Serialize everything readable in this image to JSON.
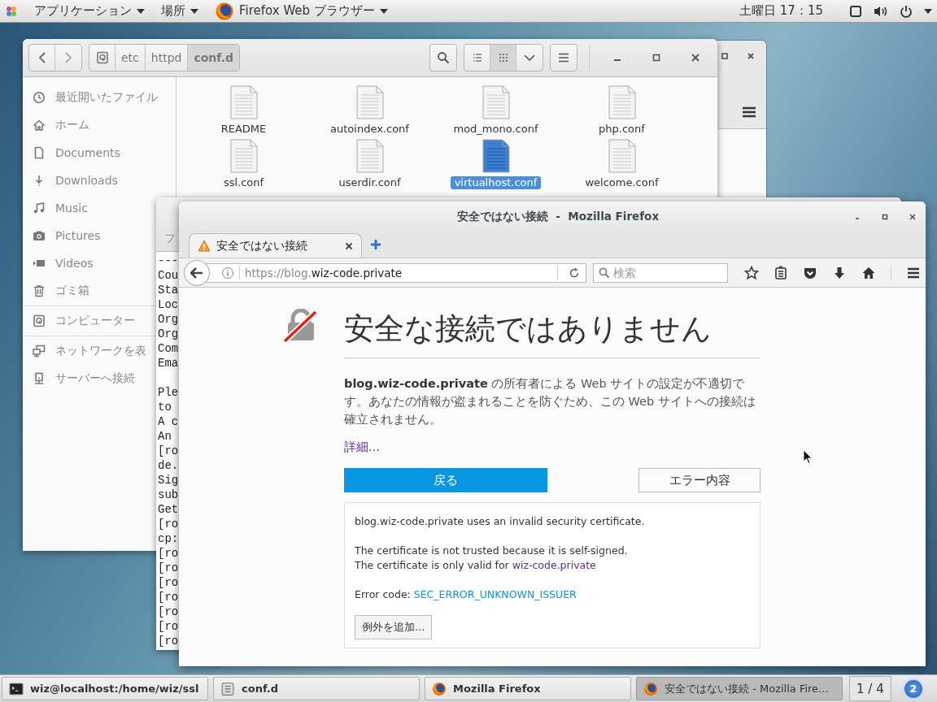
{
  "top_bar": {
    "applications_menu": "アプリケーション",
    "places_menu": "場所",
    "app_menu": "Firefox Web ブラウザー",
    "clock": "土曜日 17：15"
  },
  "file_manager": {
    "path": [
      {
        "label": "etc",
        "selected": false
      },
      {
        "label": "httpd",
        "selected": false
      },
      {
        "label": "conf.d",
        "selected": true
      }
    ],
    "view_buttons": [
      {
        "kind": "list",
        "selected": false
      },
      {
        "kind": "grid",
        "selected": true
      }
    ],
    "sidebar": {
      "sections": [
        {
          "items": [
            {
              "kind": "recent",
              "label": "最近開いたファイル"
            },
            {
              "kind": "home",
              "label": "ホーム"
            },
            {
              "kind": "document",
              "label": "Documents"
            },
            {
              "kind": "download",
              "label": "Downloads"
            },
            {
              "kind": "music",
              "label": "Music"
            },
            {
              "kind": "pictures",
              "label": "Pictures"
            },
            {
              "kind": "videos",
              "label": "Videos"
            },
            {
              "kind": "trash",
              "label": "ゴミ箱"
            }
          ]
        },
        {
          "items": [
            {
              "kind": "computer",
              "label": "コンピューター"
            }
          ]
        },
        {
          "items": [
            {
              "kind": "network",
              "label": "ネットワークを表"
            },
            {
              "kind": "server",
              "label": "サーバーへ接続"
            }
          ]
        }
      ]
    },
    "files": [
      {
        "name": "README",
        "selected": false
      },
      {
        "name": "autoindex.conf",
        "selected": false
      },
      {
        "name": "mod_mono.conf",
        "selected": false
      },
      {
        "name": "php.conf",
        "selected": false
      },
      {
        "name": "ssl.conf",
        "selected": false
      },
      {
        "name": "userdir.conf",
        "selected": false
      },
      {
        "name": "virtualhost.conf",
        "selected": true
      },
      {
        "name": "welcome.conf",
        "selected": false
      }
    ]
  },
  "terminal": {
    "menu": "フ",
    "blocks": [
      [
        "---",
        "Cou",
        "Sta",
        "Loc",
        "Org",
        "Org",
        "Com",
        "Ema"
      ],
      [
        "Ple",
        "to",
        "A c",
        "An",
        "[ro",
        "de.",
        "Sig",
        "sub",
        "Get",
        "[ro",
        "cp:",
        "[ro",
        "[ro",
        "[ro",
        "[ro",
        "[ro",
        "[ro",
        "[ro"
      ]
    ]
  },
  "browser": {
    "title": "安全ではない接続  -  Mozilla Firefox",
    "tab": {
      "title": "安全ではない接続"
    },
    "url": {
      "scheme": "https://blog.",
      "host": "wiz-code.private"
    },
    "search": {
      "placeholder": "検索"
    },
    "page": {
      "heading": "安全な接続ではありません",
      "message": "**blog.wiz-code.private** の所有者による Web サイトの設定が不適切です。あなたの情報が盗まれることを防ぐため、この Web サイトへの接続は確立されません。",
      "details_link": "詳細...",
      "back_button": "戻る",
      "error_button": "エラー内容",
      "details": {
        "summary": "blog.wiz-code.private uses an invalid security certificate.",
        "reason": "The certificate is not trusted because it is self-signed.",
        "valid_for_text": "The certificate is only valid for",
        "valid_for_link": "wiz-code.private",
        "error_code_label": "Error code:",
        "error_code": "SEC_ERROR_UNKNOWN_ISSUER",
        "exception_button": "例外を追加..."
      }
    }
  },
  "taskbar": {
    "items": [
      {
        "kind": "terminal",
        "label": "wiz@localhost:/home/wiz/ssl",
        "selected": false
      },
      {
        "kind": "files",
        "label": "conf.d",
        "selected": false
      },
      {
        "kind": "browser",
        "label": "Mozilla Firefox",
        "selected": false
      },
      {
        "kind": "browser",
        "label": "安全ではない接続  -  Mozilla Fire…",
        "selected": true
      }
    ],
    "workspace": "1 / 4",
    "notifications": "2"
  }
}
